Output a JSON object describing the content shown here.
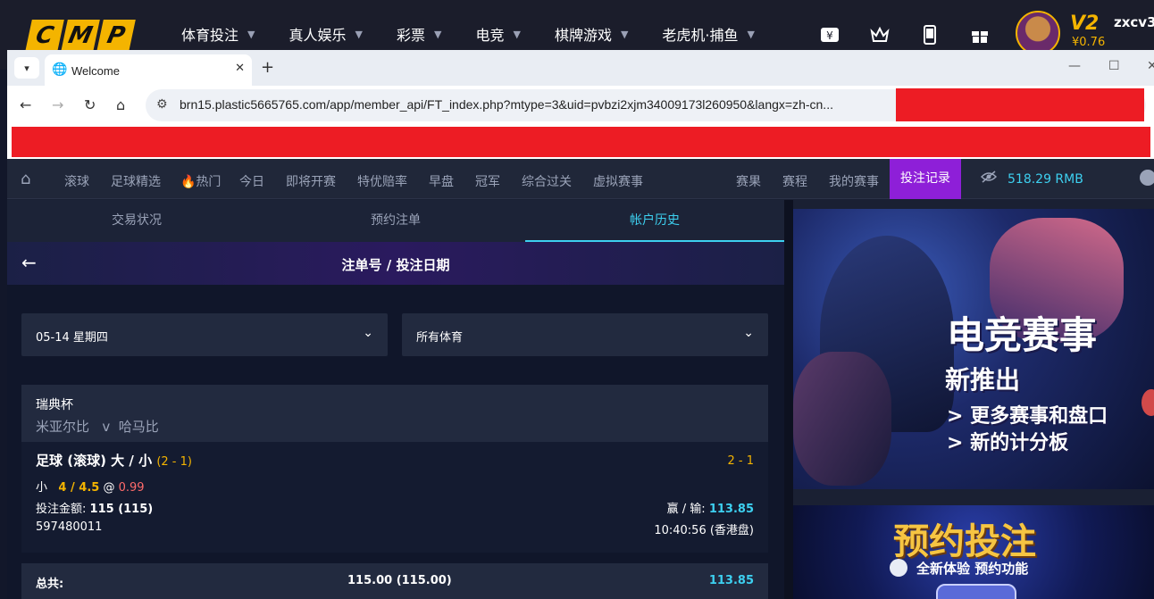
{
  "site": {
    "logo_letters": [
      "C",
      "M",
      "P"
    ],
    "nav": [
      "体育投注",
      "真人娱乐",
      "彩票",
      "电竞",
      "棋牌游戏",
      "老虎机·捕鱼"
    ],
    "vip": "V2",
    "balance": "¥0.76",
    "username": "zxcv3"
  },
  "browser": {
    "tab_title": "Welcome",
    "url": "brn15.plastic5665765.com/app/member_api/FT_index.php?mtype=3&uid=pvbzi2xjm34009173l260950&langx=zh-cn..."
  },
  "menu": {
    "items": [
      "滚球",
      "足球精选",
      "🔥热门",
      "今日",
      "即将开赛",
      "特优赔率",
      "早盘",
      "冠军",
      "综合过关",
      "虚拟赛事",
      "赛果",
      "赛程",
      "我的赛事"
    ],
    "active": "投注记录",
    "balance": "518.29  RMB"
  },
  "subtabs": [
    "交易状况",
    "预约注单",
    "帐户历史"
  ],
  "banner_title": "注单号 / 投注日期",
  "filters": {
    "date": "05-14 星期四",
    "sport": "所有体育"
  },
  "bet": {
    "league": "瑞典杯",
    "home": "米亚尔比",
    "vs": "v",
    "away": "哈马比",
    "type": "足球 (滚球) 大 / 小",
    "score_inline": "(2 - 1)",
    "score": "2 - 1",
    "pick": "小",
    "line": "4 / 4.5",
    "at": "@",
    "odds": "0.99",
    "stake_label": "投注金额:",
    "stake_value": "115 (115)",
    "winloss_label": "赢 / 输:",
    "winloss_value": "113.85",
    "bet_no": "597480011",
    "time": "10:40:56 (香港盘)"
  },
  "total": {
    "label": "总共:",
    "stake": "115.00 (115.00)",
    "winloss": "113.85"
  },
  "promo1": {
    "title": "电竞赛事",
    "subtitle": "新推出",
    "line1": "> 更多赛事和盘口",
    "line2": "> 新的计分板"
  },
  "promo2": {
    "title": "预约投注",
    "subtitle": "全新体验 预约功能"
  },
  "colors": {
    "accent_cyan": "#3dd0f0",
    "accent_purple": "#8e1fd8",
    "gold": "#f4b400",
    "odds_red": "#ff6b6b"
  }
}
